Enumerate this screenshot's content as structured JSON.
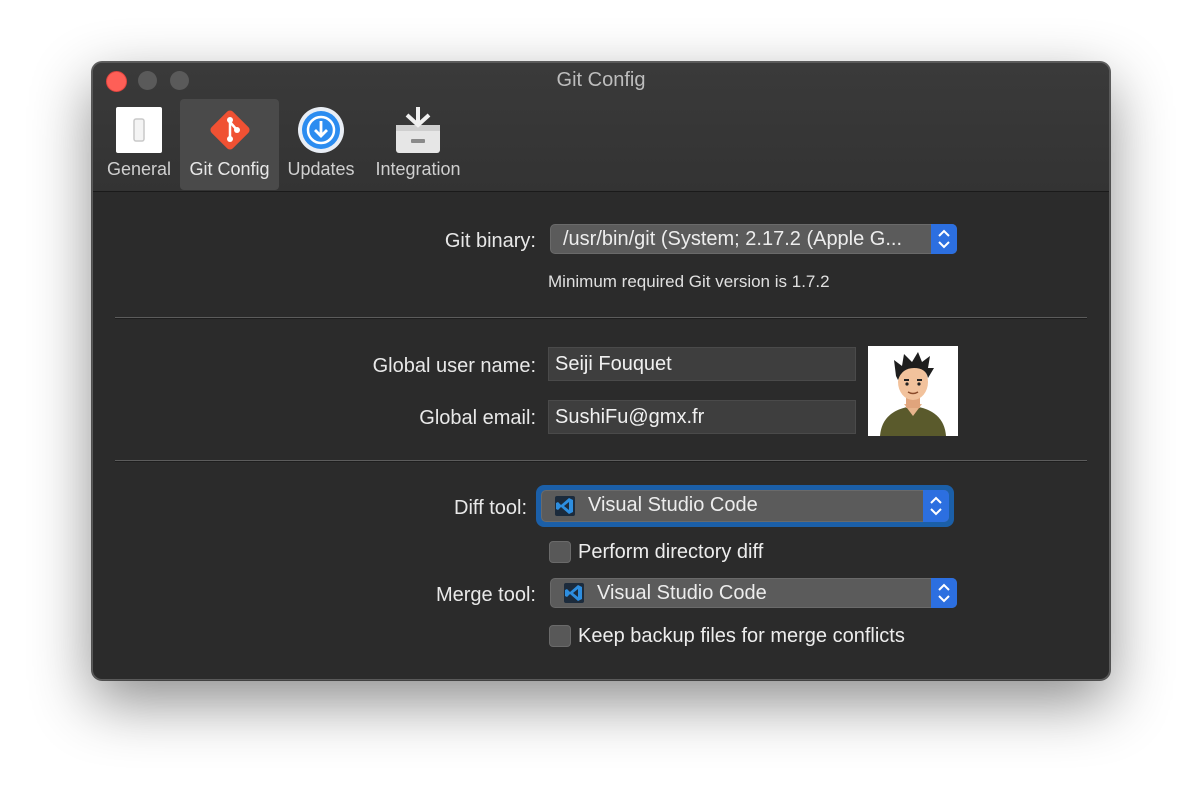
{
  "window": {
    "title": "Git Config"
  },
  "toolbar": {
    "tabs": [
      {
        "label": "General",
        "icon": "switch-icon"
      },
      {
        "label": "Git Config",
        "icon": "git-icon",
        "active": true
      },
      {
        "label": "Updates",
        "icon": "download-icon"
      },
      {
        "label": "Integration",
        "icon": "inbox-tray-icon"
      }
    ]
  },
  "git": {
    "binary_label": "Git binary:",
    "binary_value": "/usr/bin/git (System; 2.17.2 (Apple G...",
    "min_version_note": "Minimum required Git version is 1.7.2"
  },
  "user": {
    "name_label": "Global user name:",
    "name_value": "Seiji Fouquet",
    "email_label": "Global email:",
    "email_value": "SushiFu@gmx.fr"
  },
  "tools": {
    "diff_label": "Diff tool:",
    "diff_value": "Visual Studio Code",
    "dir_diff_label": "Perform directory diff",
    "dir_diff_checked": false,
    "merge_label": "Merge tool:",
    "merge_value": "Visual Studio Code",
    "backup_label": "Keep backup files for merge conflicts",
    "backup_checked": false
  },
  "colors": {
    "accent": "#2c6fe0",
    "close": "#fe5f57",
    "git": "#f05133"
  }
}
